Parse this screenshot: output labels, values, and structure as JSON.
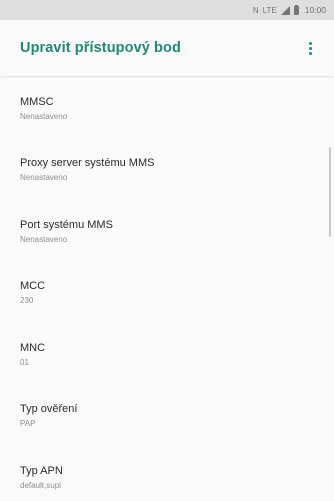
{
  "status_bar": {
    "nfc": "N",
    "network": "LTE",
    "time": "10:00"
  },
  "toolbar": {
    "title": "Upravit přístupový bod",
    "accent_color": "#1f8a70"
  },
  "preferences": [
    {
      "title": "MMSC",
      "summary": "Nenastaveno"
    },
    {
      "title": "Proxy server systému MMS",
      "summary": "Nenastaveno"
    },
    {
      "title": "Port systému MMS",
      "summary": "Nenastaveno"
    },
    {
      "title": "MCC",
      "summary": "230"
    },
    {
      "title": "MNC",
      "summary": "01"
    },
    {
      "title": "Typ ověření",
      "summary": "PAP"
    },
    {
      "title": "Typ APN",
      "summary": "default,supl"
    }
  ]
}
